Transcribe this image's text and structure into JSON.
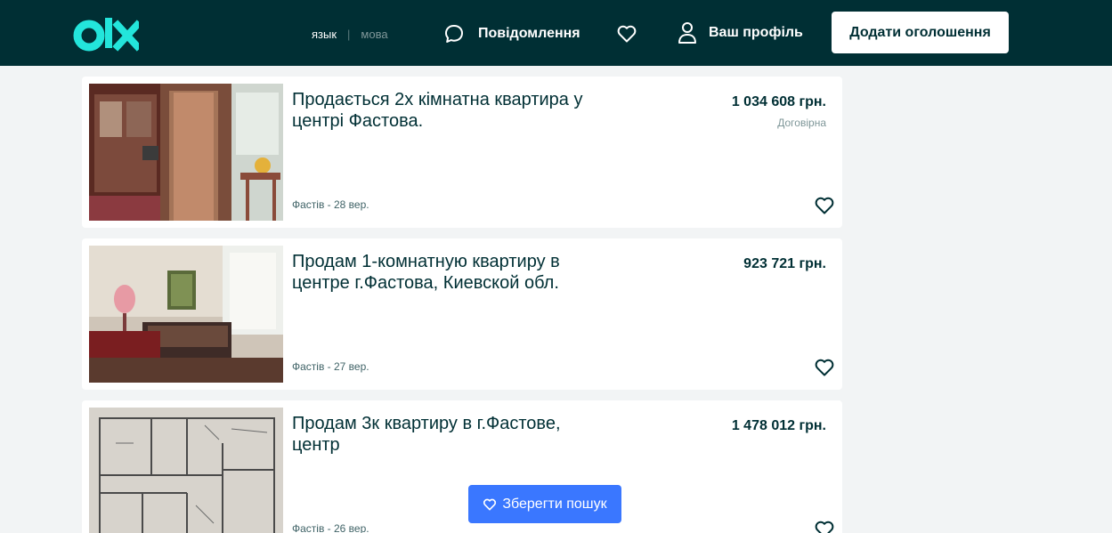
{
  "header": {
    "logo_text": "olx",
    "lang_active": "язык",
    "lang_inactive": "мова",
    "messages_label": "Повідомлення",
    "profile_label": "Ваш профіль",
    "add_button_label": "Додати оголошення"
  },
  "listings": [
    {
      "title": "Продається 2х кімнатна квартира у центрі Фастова.",
      "price": "1 034 608 грн.",
      "negotiable": "Договірна",
      "location_date": "Фастів - 28 вер."
    },
    {
      "title": "Продам 1-комнатную квартиру в центре г.Фастова, Киевской обл.",
      "price": "923 721 грн.",
      "negotiable": "",
      "location_date": "Фастів - 27 вер."
    },
    {
      "title": "Продам 3к квартиру в г.Фастове, центр",
      "price": "1 478 012 грн.",
      "negotiable": "",
      "location_date": "Фастів - 26 вер."
    }
  ],
  "save_search_label": "Зберегти пошук",
  "colors": {
    "header_bg": "#002f34",
    "logo_accent": "#23e5db",
    "save_button": "#3a77ff"
  }
}
